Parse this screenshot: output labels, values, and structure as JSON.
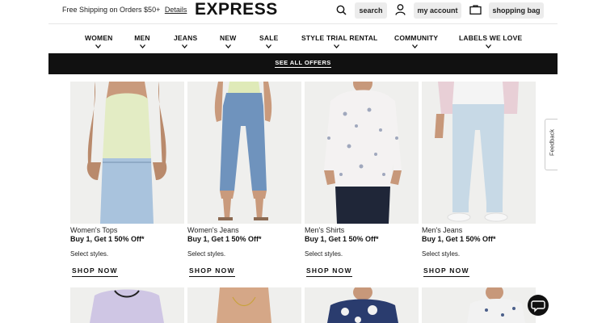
{
  "header": {
    "promo_text": "Free Shipping on Orders $50+",
    "promo_link": "Details",
    "logo": "EXPRESS",
    "search_label": "search",
    "account_label": "my account",
    "bag_label": "shopping bag",
    "icons": [
      "search-icon",
      "user-icon",
      "bag-icon"
    ]
  },
  "nav": {
    "items": [
      {
        "label": "WOMEN"
      },
      {
        "label": "MEN"
      },
      {
        "label": "JEANS"
      },
      {
        "label": "NEW"
      },
      {
        "label": "SALE"
      },
      {
        "label": "STYLE TRIAL RENTAL"
      },
      {
        "label": "COMMUNITY"
      },
      {
        "label": "LABELS WE LOVE"
      }
    ]
  },
  "offers_bar": {
    "label": "SEE ALL OFFERS"
  },
  "products": [
    {
      "category": "Women's Tops",
      "deal": "Buy 1, Get 1 50% Off*",
      "note": "Select styles.",
      "cta": "SHOP NOW"
    },
    {
      "category": "Women's Jeans",
      "deal": "Buy 1, Get 1 50% Off*",
      "note": "Select styles.",
      "cta": "SHOP NOW"
    },
    {
      "category": "Men's Shirts",
      "deal": "Buy 1, Get 1 50% Off*",
      "note": "Select styles.",
      "cta": "SHOP NOW"
    },
    {
      "category": "Men's Jeans",
      "deal": "Buy 1, Get 1 50% Off*",
      "note": "Select styles.",
      "cta": "SHOP NOW"
    }
  ],
  "feedback_label": "Feedback",
  "colors": {
    "bar": "#111111",
    "pill": "#ececec",
    "text": "#111111"
  }
}
